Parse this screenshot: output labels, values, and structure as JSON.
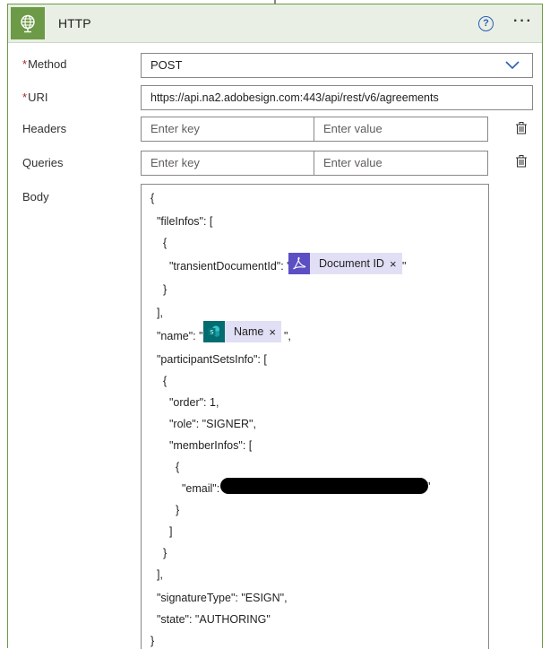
{
  "header": {
    "title": "HTTP",
    "help": "?",
    "more": "···"
  },
  "method": {
    "label": "Method",
    "required_mark": "*",
    "value": "POST"
  },
  "uri": {
    "label": "URI",
    "required_mark": "*",
    "value": "https://api.na2.adobesign.com:443/api/rest/v6/agreements"
  },
  "headers": {
    "label": "Headers",
    "key_placeholder": "Enter key",
    "value_placeholder": "Enter value"
  },
  "queries": {
    "label": "Queries",
    "key_placeholder": "Enter key",
    "value_placeholder": "Enter value"
  },
  "body": {
    "label": "Body",
    "lines": [
      "{",
      "\"fileInfos\": [",
      "{",
      "\"transientDocumentId\": \"",
      "}",
      "],",
      "\"name\": \"",
      "\"participantSetsInfo\": [",
      "{",
      "\"order\": 1,",
      "\"role\": \"SIGNER\",",
      "\"memberInfos\": [",
      "{",
      "\"email\":",
      "}",
      "]",
      "}",
      "],",
      "\"signatureType\": \"ESIGN\",",
      "\"state\": \"AUTHORING\"",
      "}"
    ],
    "close_quote": "\"",
    "close_quote_comma": "\",",
    "tokens": {
      "document_id": {
        "label": "Document ID",
        "remove": "×",
        "icon": "adobe-acrobat-icon",
        "color": "#5c4fc4"
      },
      "name": {
        "label": "Name",
        "remove": "×",
        "icon": "sharepoint-icon",
        "color": "#036c70"
      }
    }
  },
  "colors": {
    "accent": "#6c9a46",
    "header_bg": "#e9efe4",
    "token_bg": "#e1dff5",
    "help": "#2b5fb4"
  }
}
